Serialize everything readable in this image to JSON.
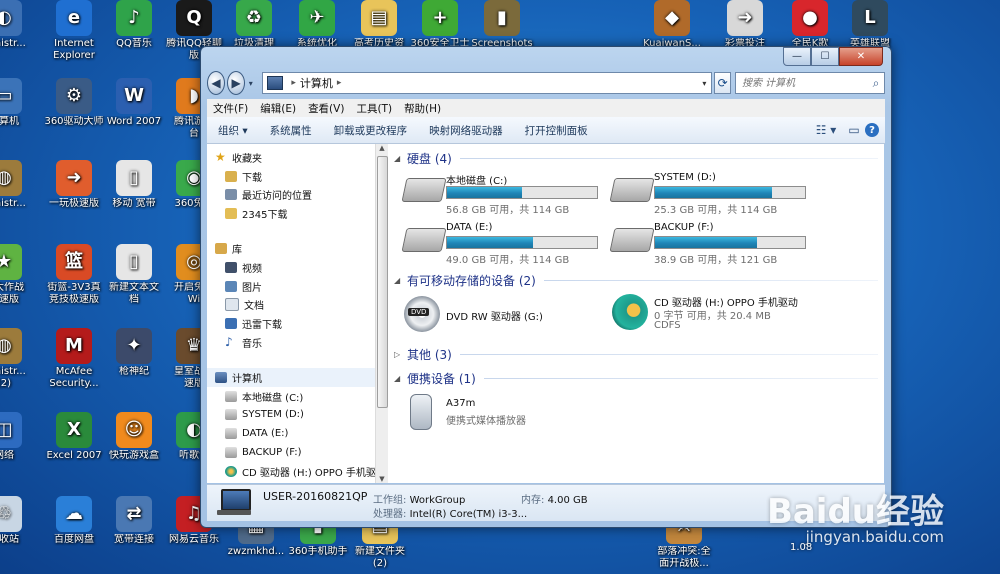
{
  "desktop": {
    "icons": [
      {
        "label": "ministr...",
        "sub": "",
        "color": "#3b6fb3",
        "glyph": "◐"
      },
      {
        "label": "Internet",
        "sub": "Explorer",
        "color": "#1f6fd1",
        "glyph": "e"
      },
      {
        "label": "QQ音乐",
        "sub": "",
        "color": "#2fa34a",
        "glyph": "♪"
      },
      {
        "label": "腾讯QQ轻聊",
        "sub": "版",
        "color": "#1a1a1a",
        "glyph": "Q"
      },
      {
        "label": "垃圾清理",
        "sub": "",
        "color": "#37a84a",
        "glyph": "♻"
      },
      {
        "label": "系统优化",
        "sub": "",
        "color": "#31a645",
        "glyph": "✈"
      },
      {
        "label": "高考历史资",
        "sub": "",
        "color": "#e8c45a",
        "glyph": "▤"
      },
      {
        "label": "360安全卫士",
        "sub": "",
        "color": "#3fa935",
        "glyph": "+"
      },
      {
        "label": "Screenshots",
        "sub": "",
        "color": "#7b6a3b",
        "glyph": "▮"
      },
      {
        "label": "KuaiwanS...",
        "sub": "",
        "color": "#b06a2a",
        "glyph": "◆"
      },
      {
        "label": "彩票投注",
        "sub": "",
        "color": "#d8d8d8",
        "glyph": "➜"
      },
      {
        "label": "全民K歌",
        "sub": "",
        "color": "#d8262c",
        "glyph": "●"
      },
      {
        "label": "英雄联盟",
        "sub": "",
        "color": "#2f4a5e",
        "glyph": "L"
      },
      {
        "label": "计算机",
        "sub": "",
        "color": "#3b73b8",
        "glyph": "▭"
      },
      {
        "label": "360驱动大师",
        "sub": "",
        "color": "#3a5b86",
        "glyph": "⚙"
      },
      {
        "label": "Word 2007",
        "sub": "",
        "color": "#2b5fb0",
        "glyph": "W"
      },
      {
        "label": "腾讯游戏",
        "sub": "台",
        "color": "#e07a1d",
        "glyph": "◗"
      },
      {
        "label": "ministr...",
        "sub": "",
        "color": "#9c7b3c",
        "glyph": "◍"
      },
      {
        "label": "一玩极速版",
        "sub": "",
        "color": "#e05d2d",
        "glyph": "➜"
      },
      {
        "label": "移动 宽带",
        "sub": "",
        "color": "#e6e6e6",
        "glyph": "▯"
      },
      {
        "label": "360免费",
        "sub": "",
        "color": "#39a94b",
        "glyph": "◉"
      },
      {
        "label": "求大作战",
        "sub": "极速版",
        "color": "#5fb342",
        "glyph": "★"
      },
      {
        "label": "街篮-3V3真",
        "sub": "竞技极速版",
        "color": "#d94a25",
        "glyph": "篮"
      },
      {
        "label": "新建文本文",
        "sub": "档",
        "color": "#e6e6e6",
        "glyph": "▯"
      },
      {
        "label": "开启免费",
        "sub": "Wi",
        "color": "#e18d1e",
        "glyph": "◎"
      },
      {
        "label": "ministr...",
        "sub": "(2)",
        "color": "#9c7b3c",
        "glyph": "◍"
      },
      {
        "label": "McAfee",
        "sub": "Security...",
        "color": "#b41b1b",
        "glyph": "M"
      },
      {
        "label": "枪神纪",
        "sub": "",
        "color": "#3c4a6a",
        "glyph": "✦"
      },
      {
        "label": "皇室战争",
        "sub": "速版",
        "color": "#6a4b2d",
        "glyph": "♛"
      },
      {
        "label": "网络",
        "sub": "",
        "color": "#2d6bc0",
        "glyph": "◫"
      },
      {
        "label": "Excel 2007",
        "sub": "",
        "color": "#2a8a3b",
        "glyph": "X"
      },
      {
        "label": "快玩游戏盒",
        "sub": "",
        "color": "#f08a1d",
        "glyph": "☺"
      },
      {
        "label": "听歌识",
        "sub": "",
        "color": "#2d9b4a",
        "glyph": "◐"
      },
      {
        "label": "回收站",
        "sub": "",
        "color": "#c8d6e4",
        "glyph": "♲"
      },
      {
        "label": "百度网盘",
        "sub": "",
        "color": "#2a7fd8",
        "glyph": "☁"
      },
      {
        "label": "宽带连接",
        "sub": "",
        "color": "#4a78b3",
        "glyph": "⇄"
      },
      {
        "label": "网易云音乐",
        "sub": "",
        "color": "#c41f23",
        "glyph": "♫"
      },
      {
        "label": "zwzmkhd...",
        "sub": "",
        "color": "#4f6a8a",
        "glyph": "▦"
      },
      {
        "label": "360手机助手",
        "sub": "",
        "color": "#3aa74a",
        "glyph": "▮"
      },
      {
        "label": "新建文件夹",
        "sub": "(2)",
        "color": "#e8c45a",
        "glyph": "▤"
      },
      {
        "label": "部落冲突:全",
        "sub": "面开战极...",
        "color": "#c3873d",
        "glyph": "⚔"
      }
    ]
  },
  "window": {
    "caption": {
      "minimize": "—",
      "maximize": "☐",
      "close": "✕"
    },
    "nav": {
      "back": "◀",
      "forward": "▶",
      "recent": "▾"
    },
    "address": {
      "path": "计算机",
      "sep1": "▸",
      "sep2": "▸",
      "dropdown": "▾"
    },
    "refresh": "⟳",
    "search": {
      "placeholder": "搜索 计算机",
      "icon": "⌕"
    },
    "menu": [
      "文件(F)",
      "编辑(E)",
      "查看(V)",
      "工具(T)",
      "帮助(H)"
    ],
    "toolbar": {
      "organize": "组织 ▾",
      "items": [
        "系统属性",
        "卸载或更改程序",
        "映射网络驱动器",
        "打开控制面板"
      ],
      "views_icon": "☷ ▾",
      "preview_icon": "▭",
      "help_icon": "?"
    },
    "navpane": {
      "favorites": {
        "header": "收藏夹",
        "items": [
          "下载",
          "最近访问的位置",
          "2345下载"
        ]
      },
      "libraries": {
        "header": "库",
        "items": [
          "视频",
          "图片",
          "文档",
          "迅雷下载",
          "音乐"
        ]
      },
      "computer": {
        "header": "计算机",
        "items": [
          "本地磁盘 (C:)",
          "SYSTEM (D:)",
          "DATA (E:)",
          "BACKUP (F:)",
          "CD 驱动器 (H:) OPPO 手机驱"
        ]
      },
      "scroll_up": "▲",
      "scroll_down": "▼"
    },
    "content": {
      "hard_disks": {
        "header": "硬盘 (4)",
        "drives": [
          {
            "name": "本地磁盘 (C:)",
            "free_text": "56.8 GB 可用，共 114 GB",
            "used_fraction": 0.502
          },
          {
            "name": "SYSTEM (D:)",
            "free_text": "25.3 GB 可用，共 114 GB",
            "used_fraction": 0.778
          },
          {
            "name": "DATA (E:)",
            "free_text": "49.0 GB 可用，共 114 GB",
            "used_fraction": 0.57
          },
          {
            "name": "BACKUP (F:)",
            "free_text": "38.9 GB 可用，共 121 GB",
            "used_fraction": 0.679
          }
        ]
      },
      "removable": {
        "header": "有可移动存储的设备 (2)",
        "dvd": {
          "name": "DVD RW 驱动器 (G:)",
          "badge": "DVD"
        },
        "cd": {
          "name": "CD 驱动器 (H:) OPPO 手机驱动",
          "free_text": "0 字节 可用，共 20.4 MB",
          "fs": "CDFS"
        }
      },
      "other": {
        "header": "其他 (3)"
      },
      "portable": {
        "header": "便携设备 (1)",
        "device": {
          "name": "A37m",
          "desc": "便携式媒体播放器"
        }
      }
    },
    "details": {
      "host": "USER-20160821QP",
      "workgroup_label": "工作组:",
      "workgroup": "WorkGroup",
      "memory_label": "内存:",
      "memory": "4.00 GB",
      "cpu_label": "处理器:",
      "cpu": "Intel(R) Core(TM) i3-3..."
    }
  },
  "watermark": {
    "main": "Baidu经验",
    "sub": "jingyan.baidu.com"
  },
  "clock": {
    "line1": "1.08"
  }
}
